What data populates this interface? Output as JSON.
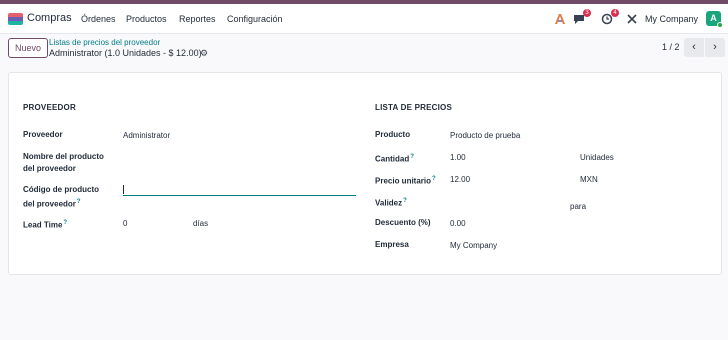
{
  "app": {
    "name": "Compras"
  },
  "menu": [
    "Órdenes",
    "Productos",
    "Reportes",
    "Configuración"
  ],
  "systray": {
    "messages_count": "3",
    "activities_count": "4",
    "company": "My Company",
    "avatar_letter": "A"
  },
  "control_panel": {
    "new_button": "Nuevo",
    "breadcrumb_parent": "Listas de precios del proveedor",
    "record_title": "Administrator (1.0 Unidades - $ 12.00)",
    "pager": "1 / 2"
  },
  "colors": {
    "brand": "#714b67",
    "accent": "#017e84"
  },
  "icons": [
    "compras-app-icon",
    "ai-icon",
    "chat-icon",
    "clock-icon",
    "tools-icon",
    "gear-icon",
    "chevron-left-icon",
    "chevron-right-icon"
  ],
  "left": {
    "title": "PROVEEDOR",
    "proveedor_label": "Proveedor",
    "proveedor_value": "Administrator",
    "product_name_label_1": "Nombre del producto",
    "product_name_label_2": "del proveedor",
    "product_code_label_1": "Código de producto",
    "product_code_label_2": "del proveedor",
    "lead_time_label": "Lead Time",
    "lead_time_value": "0",
    "lead_time_unit": "días"
  },
  "right": {
    "title": "LISTA DE PRECIOS",
    "producto_label": "Producto",
    "producto_value": "Producto de prueba",
    "cantidad_label": "Cantidad",
    "cantidad_value": "1.00",
    "cantidad_unit": "Unidades",
    "precio_label": "Precio unitario",
    "precio_value": "12.00",
    "precio_currency": "MXN",
    "validez_label": "Validez",
    "validez_sep": "para",
    "descuento_label": "Descuento (%)",
    "descuento_value": "0.00",
    "empresa_label": "Empresa",
    "empresa_value": "My Company"
  },
  "help_mark": "?"
}
